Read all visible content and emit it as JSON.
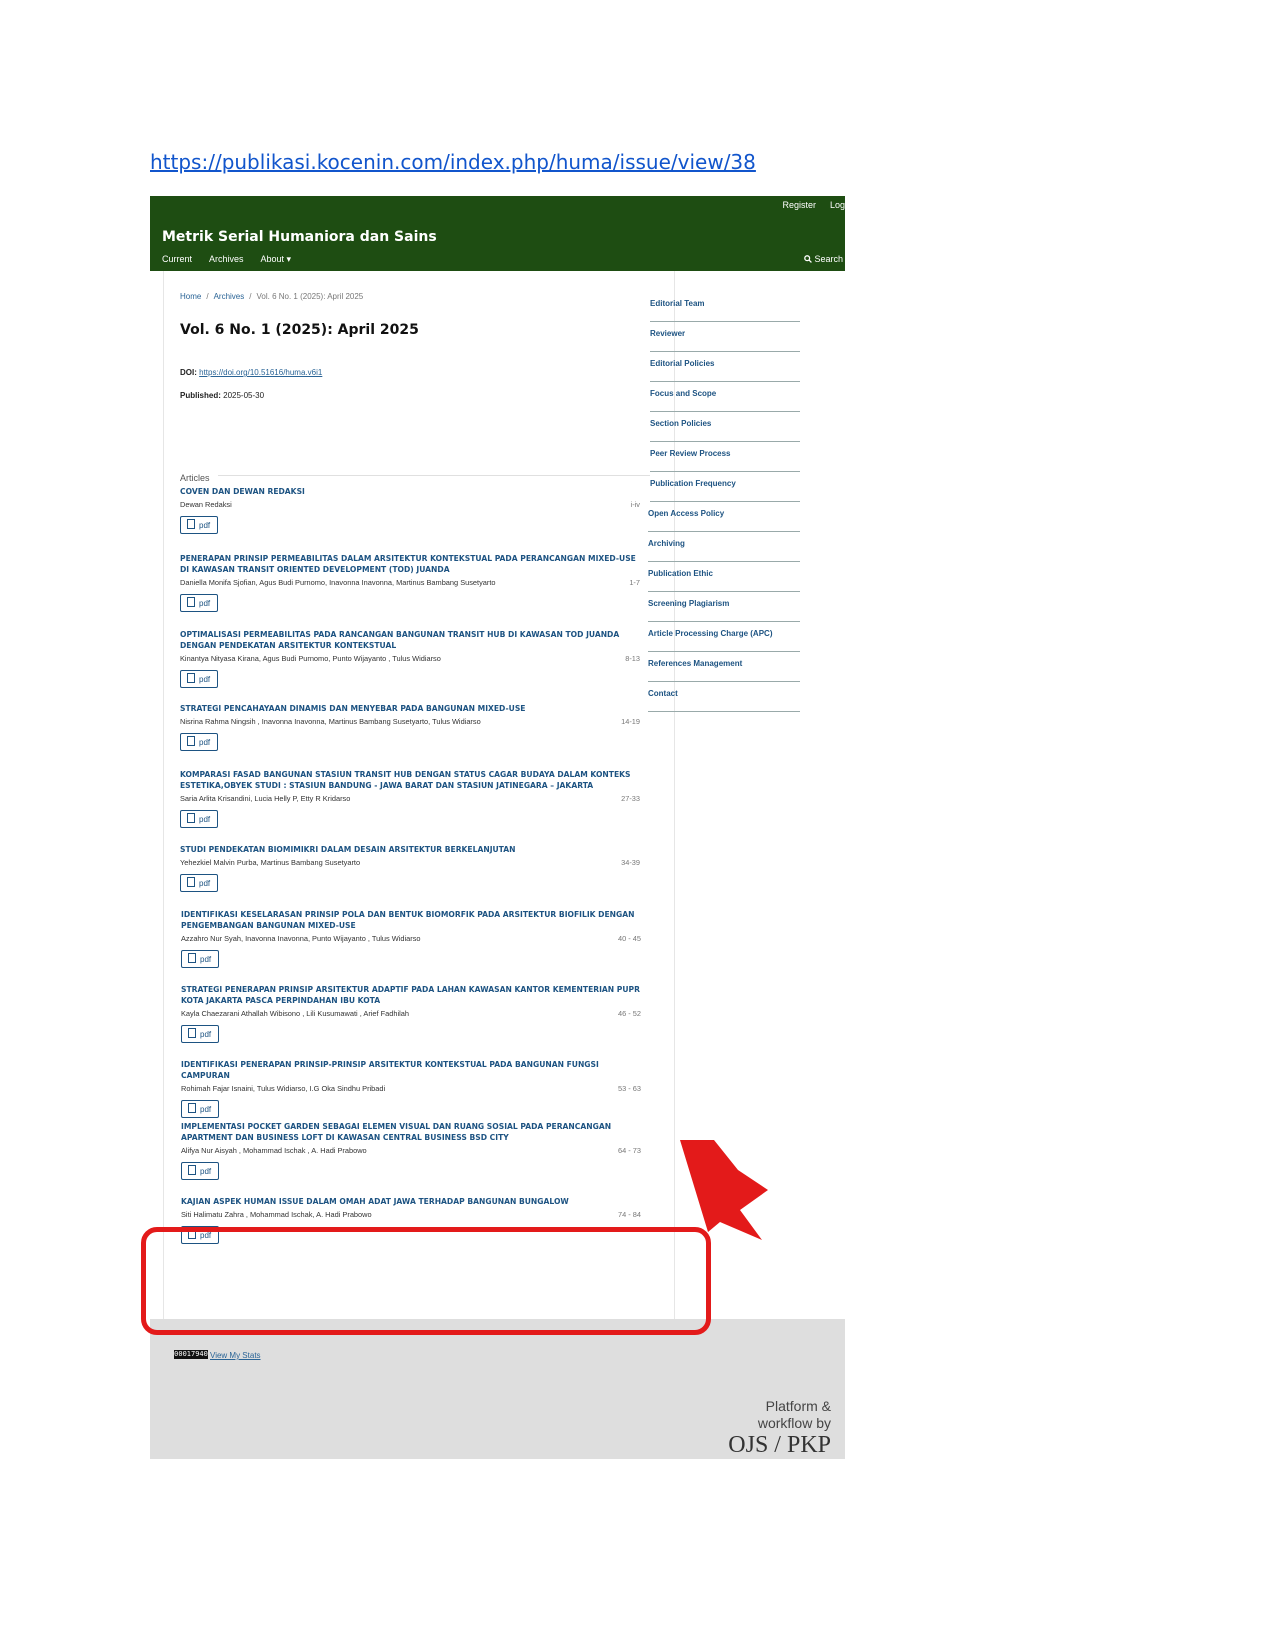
{
  "url": "https://publikasi.kocenin.com/index.php/huma/issue/view/38",
  "header": {
    "user_nav": [
      "Register",
      "Log"
    ],
    "site_title": "Metrik Serial Humaniora dan Sains",
    "nav": [
      "Current",
      "Archives",
      "About ▾"
    ],
    "search": "Search"
  },
  "breadcrumb": {
    "home": "Home",
    "archives": "Archives",
    "current": "Vol. 6 No. 1 (2025): April 2025"
  },
  "issue": {
    "title": "Vol. 6 No. 1 (2025): April 2025",
    "doi_label": "DOI:",
    "doi": "https://doi.org/10.51616/huma.v6i1",
    "published_label": "Published:",
    "published": "2025-05-30"
  },
  "section_title": "Articles",
  "pdf_label": "pdf",
  "articles": [
    {
      "title": "COVEN DAN DEWAN REDAKSI",
      "authors": "Dewan Redaksi",
      "pages": "i-iv"
    },
    {
      "title": "PENERAPAN PRINSIP PERMEABILITAS DALAM ARSITEKTUR KONTEKSTUAL PADA PERANCANGAN MIXED-USE DI KAWASAN TRANSIT ORIENTED DEVELOPMENT (TOD) JUANDA",
      "authors": "Daniella Monifa Sjofian, Agus Budi Purnomo, Inavonna Inavonna, Martinus Bambang Susetyarto",
      "pages": "1-7"
    },
    {
      "title": "OPTIMALISASI PERMEABILITAS PADA RANCANGAN BANGUNAN TRANSIT HUB DI KAWASAN TOD JUANDA DENGAN PENDEKATAN ARSITEKTUR KONTEKSTUAL",
      "authors": "Kinantya Nityasa Kirana, Agus Budi Purnomo, Punto Wijayanto , Tulus Widiarso",
      "pages": "8-13"
    },
    {
      "title": "STRATEGI PENCAHAYAAN DINAMIS DAN MENYEBAR PADA BANGUNAN MIXED-USE",
      "authors": "Nisrina Rahma Ningsih , Inavonna Inavonna, Martinus Bambang Susetyarto, Tulus Widiarso",
      "pages": "14-19"
    },
    {
      "title": "KOMPARASI FASAD BANGUNAN STASIUN TRANSIT HUB DENGAN STATUS CAGAR BUDAYA DALAM KONTEKS ESTETIKA,OBYEK STUDI : STASIUN BANDUNG - JAWA BARAT DAN STASIUN JATINEGARA – JAKARTA",
      "authors": "Saria Arlita Krisandini, Lucia Helly P, Etty R Kridarso",
      "pages": "27-33"
    },
    {
      "title": "STUDI PENDEKATAN BIOMIMIKRI DALAM DESAIN ARSITEKTUR BERKELANJUTAN",
      "authors": "Yehezkiel Malvin Purba, Martinus Bambang Susetyarto",
      "pages": "34-39"
    },
    {
      "title": "IDENTIFIKASI KESELARASAN PRINSIP POLA DAN BENTUK BIOMORFIK PADA ARSITEKTUR BIOFILIK DENGAN PENGEMBANGAN BANGUNAN MIXED-USE",
      "authors": "Azzahro Nur Syah, Inavonna Inavonna, Punto Wijayanto , Tulus Widiarso",
      "pages": "40 - 45"
    },
    {
      "title": "STRATEGI PENERAPAN PRINSIP ARSITEKTUR ADAPTIF PADA LAHAN KAWASAN KANTOR KEMENTERIAN PUPR KOTA JAKARTA PASCA PERPINDAHAN IBU KOTA",
      "authors": "Kayla Chaezarani Athallah Wibisono , Lili Kusumawati , Arief Fadhilah",
      "pages": "46 - 52"
    },
    {
      "title": "IDENTIFIKASI PENERAPAN PRINSIP-PRINSIP ARSITEKTUR KONTEKSTUAL PADA BANGUNAN FUNGSI CAMPURAN",
      "authors": "Rohimah Fajar Isnaini, Tulus Widiarso, I.G Oka Sindhu Pribadi",
      "pages": "53 - 63"
    },
    {
      "title": "IMPLEMENTASI POCKET GARDEN SEBAGAI ELEMEN VISUAL DAN RUANG SOSIAL PADA PERANCANGAN APARTMENT DAN BUSINESS LOFT DI KAWASAN CENTRAL BUSINESS BSD CITY",
      "authors": "Alifya Nur Aisyah , Mohammad Ischak , A. Hadi Prabowo",
      "pages": "64 - 73"
    },
    {
      "title": "KAJIAN ASPEK HUMAN ISSUE DALAM OMAH ADAT JAWA TERHADAP BANGUNAN BUNGALOW",
      "authors": "Siti Halimatu Zahra , Mohammad Ischak, A. Hadi Prabowo",
      "pages": "74 - 84"
    }
  ],
  "sidebar": [
    "Editorial Team",
    "Reviewer",
    "Editorial Policies",
    "Focus and Scope",
    "Section Policies",
    "Peer Review Process",
    "Publication Frequency",
    "Open Access Policy",
    "Archiving",
    "Publication Ethic",
    "Screening Plagiarism",
    "Article Processing Charge (APC)",
    "References Management",
    "Contact"
  ],
  "footer": {
    "counter": "00017940",
    "stats_link": "View My Stats",
    "platform_line1": "Platform &",
    "platform_line2": "workflow by",
    "logo": "OJS / PKP"
  },
  "colors": {
    "header_bg": "#1e4d12",
    "link": "#1d5382",
    "highlight": "#e31a1a"
  }
}
